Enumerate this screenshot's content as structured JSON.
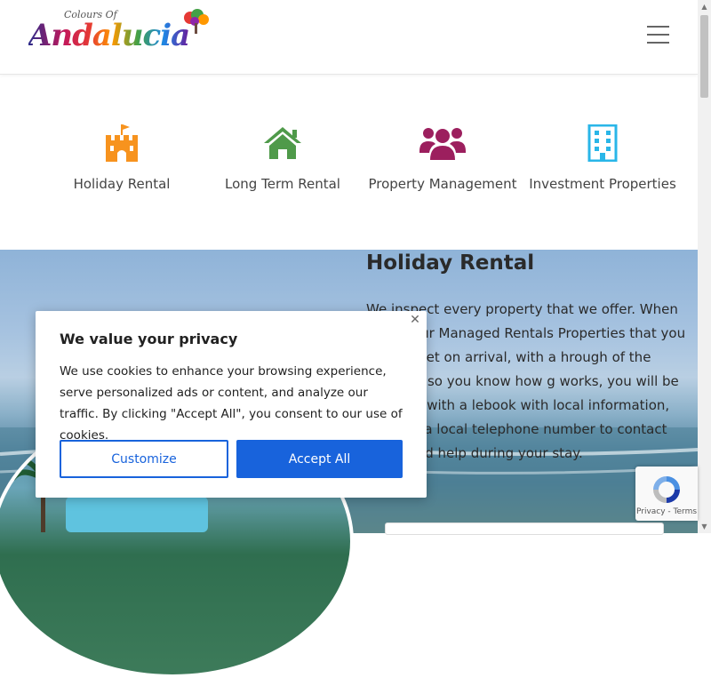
{
  "header": {
    "logo_small": "Colours Of",
    "logo_main": "Andalucia",
    "menu_icon": "hamburger-menu-icon"
  },
  "services": [
    {
      "label": "Holiday Rental",
      "icon": "castle-icon",
      "color": "#f7931e"
    },
    {
      "label": "Long Term Rental",
      "icon": "house-icon",
      "color": "#4f9a4a"
    },
    {
      "label": "Property Management",
      "icon": "users-icon",
      "color": "#9c1f5e"
    },
    {
      "label": "Investment Properties",
      "icon": "building-icon",
      "color": "#29b6e8"
    }
  ],
  "hero": {
    "title": "Holiday Rental",
    "text": "We inspect every property that we offer. When one of our Managed Rentals Properties that you will be met on arrival, with a hrough of the property so you know how g works, you will be supplied with a lebook with local information, and you a local telephone number to contact ever need help during your stay."
  },
  "cookie_banner": {
    "title": "We value your privacy",
    "text": "We use cookies to enhance your browsing experience, serve personalized ads or content, and analyze our traffic. By clicking \"Accept All\", you consent to our use of cookies.",
    "customize_label": "Customize",
    "accept_label": "Accept All",
    "accent_color": "#1863dc"
  },
  "recaptcha": {
    "links": "Privacy - Terms"
  }
}
